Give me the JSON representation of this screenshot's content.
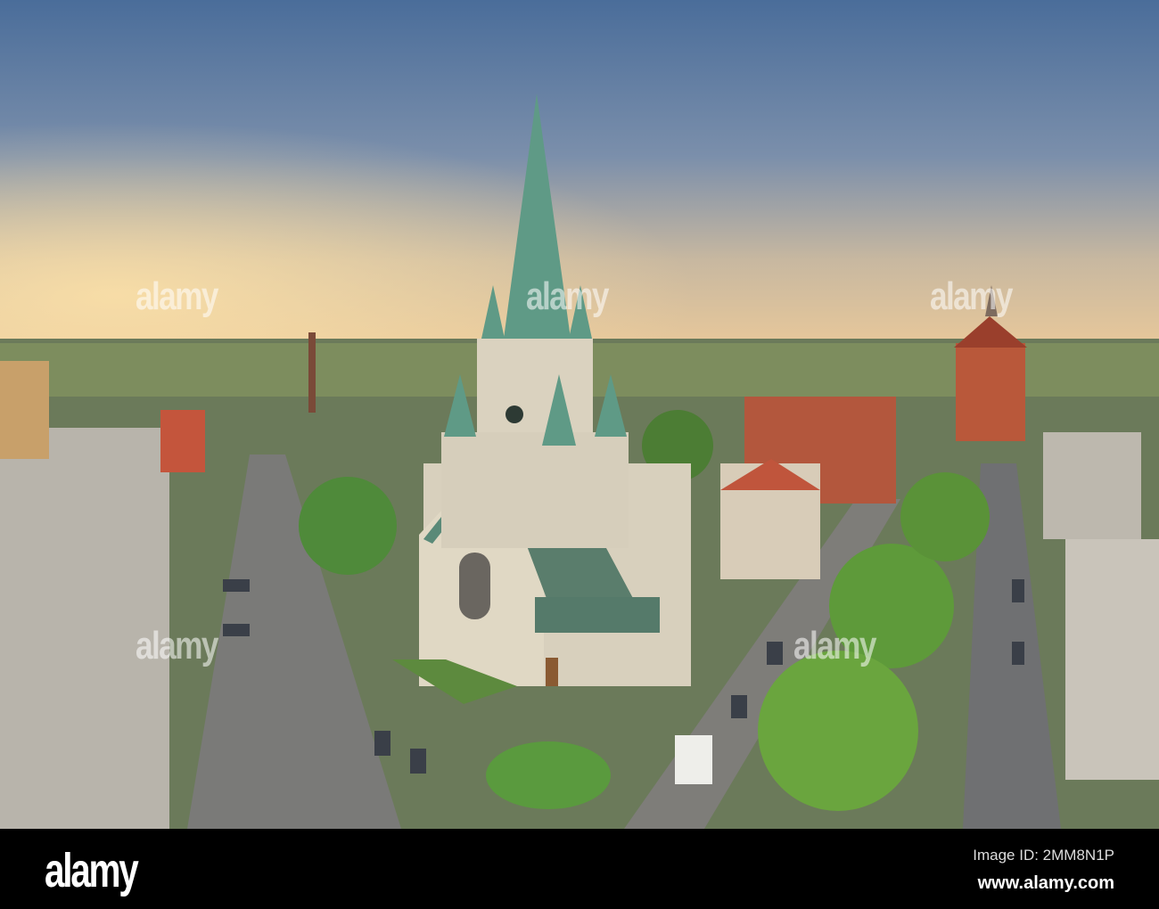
{
  "watermark": {
    "text": "alamy"
  },
  "footer": {
    "logo": "alamy",
    "image_id": "Image ID: 2MM8N1P",
    "website": "www.alamy.com"
  }
}
